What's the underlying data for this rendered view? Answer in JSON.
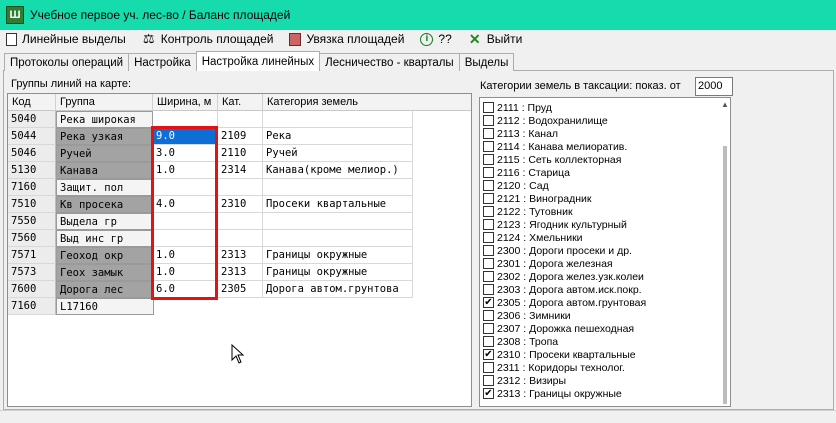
{
  "window": {
    "title": "Учебное первое уч. лес-во / Баланс площадей",
    "app_icon_glyph": "Ш"
  },
  "toolbar": {
    "items": [
      {
        "label": "Линейные выделы",
        "icon": "document-icon"
      },
      {
        "label": "Контроль площадей",
        "icon": "scales-icon"
      },
      {
        "label": "Увязка площадей",
        "icon": "ledger-icon"
      },
      {
        "label": "??",
        "icon": "help-icon"
      },
      {
        "label": "Выйти",
        "icon": "exit-icon"
      }
    ]
  },
  "tabs": [
    {
      "label": "Протоколы операций",
      "active": false
    },
    {
      "label": "Настройка",
      "active": false
    },
    {
      "label": "Настройка линейных",
      "active": true
    },
    {
      "label": "Лесничество - кварталы",
      "active": false
    },
    {
      "label": "Выделы",
      "active": false
    }
  ],
  "left_panel": {
    "label": "Группы линий на карте:",
    "columns": [
      "Код",
      "Группа",
      "Ширина, м",
      "Кат.",
      "Категория земель"
    ],
    "rows": [
      {
        "code": "5040",
        "group": "Река широкая",
        "width": "",
        "cat": "",
        "cat_name": "",
        "shade": "light"
      },
      {
        "code": "5044",
        "group": "Река узкая",
        "width": "9.0",
        "cat": "2109",
        "cat_name": "Река",
        "shade": "dark",
        "selected": true
      },
      {
        "code": "5046",
        "group": "Ручей",
        "width": "3.0",
        "cat": "2110",
        "cat_name": "Ручей",
        "shade": "dark"
      },
      {
        "code": "5130",
        "group": "Канава",
        "width": "1.0",
        "cat": "2314",
        "cat_name": "Канава(кроме мелиор.)",
        "shade": "dark"
      },
      {
        "code": "7160",
        "group": "Защит. пол",
        "width": "",
        "cat": "",
        "cat_name": "",
        "shade": "light"
      },
      {
        "code": "7510",
        "group": "Кв просека",
        "width": "4.0",
        "cat": "2310",
        "cat_name": "Просеки квартальные",
        "shade": "dark"
      },
      {
        "code": "7550",
        "group": "Выдела гр",
        "width": "",
        "cat": "",
        "cat_name": "",
        "shade": "light"
      },
      {
        "code": "7560",
        "group": "Выд инс гр",
        "width": "",
        "cat": "",
        "cat_name": "",
        "shade": "light"
      },
      {
        "code": "7571",
        "group": "Геоход окр",
        "width": "1.0",
        "cat": "2313",
        "cat_name": "Границы окружные",
        "shade": "dark"
      },
      {
        "code": "7573",
        "group": "Геох замык",
        "width": "1.0",
        "cat": "2313",
        "cat_name": "Границы окружные",
        "shade": "dark"
      },
      {
        "code": "7600",
        "group": "Дорога лес",
        "width": "6.0",
        "cat": "2305",
        "cat_name": "Дорога автом.грунтова",
        "shade": "dark"
      },
      {
        "code": "7160",
        "group": "L17160",
        "width": "",
        "cat": "",
        "cat_name": "",
        "shade": "light",
        "short": true
      }
    ]
  },
  "right_panel": {
    "label": "Категории земель в таксации:  показ. от",
    "from_value": "2000",
    "categories": [
      {
        "label": "2111 : Пруд",
        "checked": false
      },
      {
        "label": "2112 : Водохранилище",
        "checked": false
      },
      {
        "label": "2113 : Канал",
        "checked": false
      },
      {
        "label": "2114 : Канава мелиоратив.",
        "checked": false
      },
      {
        "label": "2115 : Сеть коллекторная",
        "checked": false
      },
      {
        "label": "2116 : Старица",
        "checked": false
      },
      {
        "label": "2120 : Сад",
        "checked": false
      },
      {
        "label": "2121 : Виноградник",
        "checked": false
      },
      {
        "label": "2122 : Тутовник",
        "checked": false
      },
      {
        "label": "2123 : Ягодник культурный",
        "checked": false
      },
      {
        "label": "2124 : Хмельники",
        "checked": false
      },
      {
        "label": "2300 : Дороги просеки и др.",
        "checked": false
      },
      {
        "label": "2301 : Дорога железная",
        "checked": false
      },
      {
        "label": "2302 : Дорога желез.узк.колеи",
        "checked": false
      },
      {
        "label": "2303 : Дорога автом.иск.покр.",
        "checked": false
      },
      {
        "label": "2305 : Дорога автом.грунтовая",
        "checked": true
      },
      {
        "label": "2306 : Зимники",
        "checked": false
      },
      {
        "label": "2307 : Дорожка пешеходная",
        "checked": false
      },
      {
        "label": "2308 : Тропа",
        "checked": false
      },
      {
        "label": "2310 : Просеки квартальные",
        "checked": true
      },
      {
        "label": "2311 : Коридоры технолог.",
        "checked": false
      },
      {
        "label": "2312 : Визиры",
        "checked": false
      },
      {
        "label": "2313 : Границы окружные",
        "checked": true
      }
    ]
  },
  "colors": {
    "titlebar": "#16dcad",
    "selection": "#0d6fd6",
    "highlight_box": "#e61111",
    "shaded_cell": "#a3a3a3"
  }
}
